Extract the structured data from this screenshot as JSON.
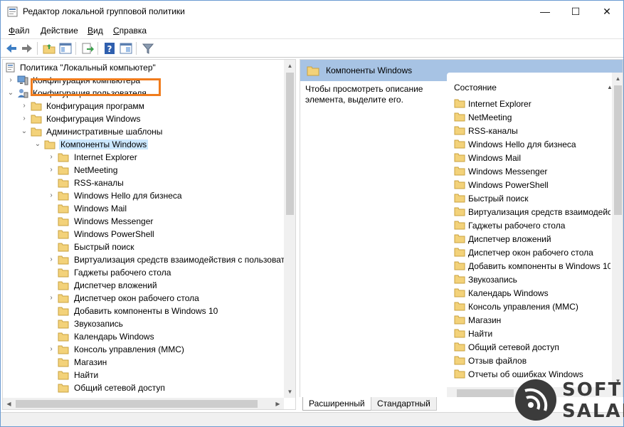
{
  "window": {
    "title": "Редактор локальной групповой политики",
    "controls": {
      "minimize": "—",
      "maximize": "☐",
      "close": "✕"
    }
  },
  "menu": [
    {
      "label": "Файл",
      "hotkey": "Ф",
      "rest": "айл"
    },
    {
      "label": "Действие",
      "hotkey": "Д",
      "rest": "ействие"
    },
    {
      "label": "Вид",
      "hotkey": "В",
      "rest": "ид"
    },
    {
      "label": "Справка",
      "hotkey": "С",
      "rest": "правка"
    }
  ],
  "toolbar": {
    "icons": [
      "back-arrow-icon",
      "forward-arrow-icon",
      "up-folder-icon",
      "show-hide-tree-icon",
      "export-list-icon",
      "help-icon",
      "properties-view-icon",
      "filter-icon"
    ]
  },
  "tree": {
    "root": "Политика \"Локальный компьютер\"",
    "computer_config": "Конфигурация компьютера",
    "user_config": "Конфигурация пользователя",
    "program_config": "Конфигурация программ",
    "windows_config": "Конфигурация Windows",
    "admin_templates": "Административные шаблоны",
    "selected": "Компоненты Windows",
    "children": [
      {
        "label": "Internet Explorer",
        "expandable": true
      },
      {
        "label": "NetMeeting",
        "expandable": true
      },
      {
        "label": "RSS-каналы",
        "expandable": false
      },
      {
        "label": "Windows Hello для бизнеса",
        "expandable": true
      },
      {
        "label": "Windows Mail",
        "expandable": false
      },
      {
        "label": "Windows Messenger",
        "expandable": false
      },
      {
        "label": "Windows PowerShell",
        "expandable": false
      },
      {
        "label": "Быстрый поиск",
        "expandable": false
      },
      {
        "label": "Виртуализация средств взаимодействия с пользовате",
        "expandable": true
      },
      {
        "label": "Гаджеты рабочего стола",
        "expandable": false
      },
      {
        "label": "Диспетчер вложений",
        "expandable": false
      },
      {
        "label": "Диспетчер окон рабочего стола",
        "expandable": true
      },
      {
        "label": "Добавить компоненты в Windows 10",
        "expandable": false
      },
      {
        "label": "Звукозапись",
        "expandable": false
      },
      {
        "label": "Календарь Windows",
        "expandable": false
      },
      {
        "label": "Консоль управления (MMC)",
        "expandable": true
      },
      {
        "label": "Магазин",
        "expandable": false
      },
      {
        "label": "Найти",
        "expandable": false
      },
      {
        "label": "Общий сетевой доступ",
        "expandable": false
      }
    ]
  },
  "right": {
    "header": "Компоненты Windows",
    "description": "Чтобы просмотреть описание элемента, выделите его.",
    "column": "Состояние",
    "items": [
      "Internet Explorer",
      "NetMeeting",
      "RSS-каналы",
      "Windows Hello для бизнеса",
      "Windows Mail",
      "Windows Messenger",
      "Windows PowerShell",
      "Быстрый поиск",
      "Виртуализация средств взаимодейст",
      "Гаджеты рабочего стола",
      "Диспетчер вложений",
      "Диспетчер окон рабочего стола",
      "Добавить компоненты в Windows 10",
      "Звукозапись",
      "Календарь Windows",
      "Консоль управления (MMC)",
      "Магазин",
      "Найти",
      "Общий сетевой доступ",
      "Отзыв файлов",
      "Отчеты об ошибках Windows"
    ]
  },
  "tabs": {
    "extended": "Расширенный",
    "standard": "Стандартный"
  },
  "watermark": {
    "line1": "SOFT",
    "line2": "SALAD"
  },
  "colors": {
    "header_blue": "#a7c3e4",
    "highlight_orange": "#f07c1d",
    "folder_yellow": "#f3d27a",
    "selection": "#cce8ff"
  }
}
